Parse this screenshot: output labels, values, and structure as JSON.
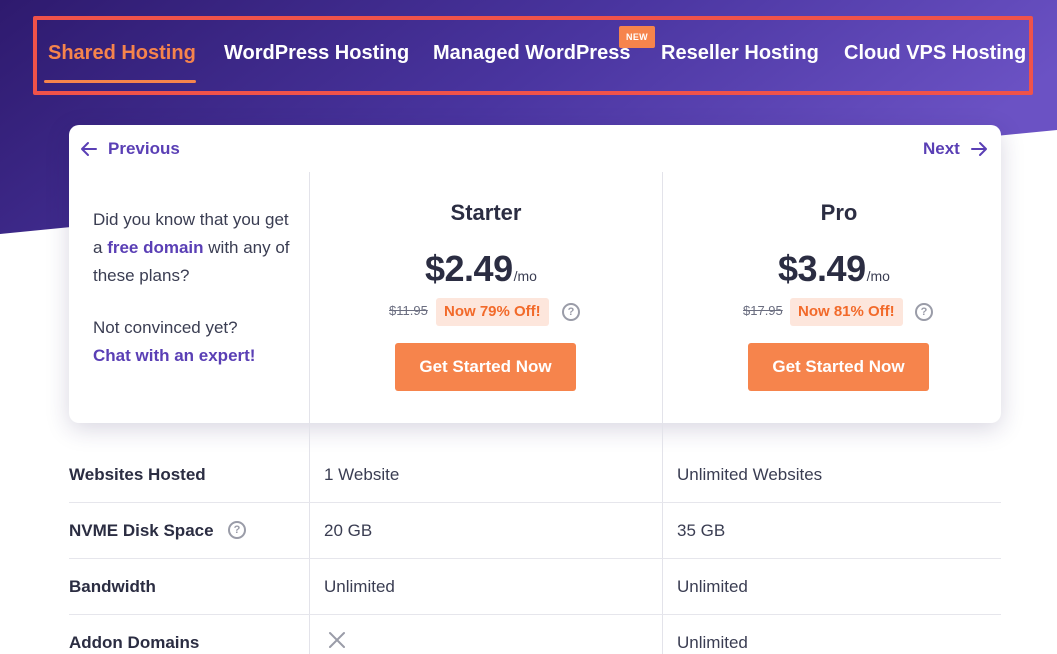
{
  "nav": {
    "tabs": [
      {
        "label": "Shared Hosting",
        "active": true
      },
      {
        "label": "WordPress Hosting",
        "active": false
      },
      {
        "label": "Managed WordPress",
        "active": false,
        "badge": "NEW"
      },
      {
        "label": "Reseller Hosting",
        "active": false
      },
      {
        "label": "Cloud VPS Hosting",
        "active": false
      }
    ]
  },
  "pager": {
    "previous_label": "Previous",
    "next_label": "Next"
  },
  "intro": {
    "line1_pre": "Did you know that you get a ",
    "line1_highlight": "free domain",
    "line1_post": " with any of these plans?",
    "line2": "Not convinced yet?",
    "chat_link": "Chat with an expert!"
  },
  "plans": [
    {
      "name": "Starter",
      "price": "$2.49",
      "per": "/mo",
      "old_price": "$11.95",
      "discount": "Now 79% Off!",
      "cta": "Get Started Now"
    },
    {
      "name": "Pro",
      "price": "$3.49",
      "per": "/mo",
      "old_price": "$17.95",
      "discount": "Now 81% Off!",
      "cta": "Get Started Now"
    }
  ],
  "features": [
    {
      "label": "Websites Hosted",
      "starter": "1 Website",
      "pro": "Unlimited Websites"
    },
    {
      "label": "NVME Disk Space",
      "starter": "20 GB",
      "pro": "35 GB",
      "has_help": true
    },
    {
      "label": "Bandwidth",
      "starter": "Unlimited",
      "pro": "Unlimited"
    },
    {
      "label": "Addon Domains",
      "starter": "",
      "starter_icon": "x-icon",
      "pro": "Unlimited"
    }
  ],
  "colors": {
    "accent_orange": "#f6844c",
    "brand_purple": "#5a3fb5",
    "highlight_frame": "#f0524a",
    "hero_dark": "#2e1a6e",
    "hero_light": "#6b52c4"
  },
  "icons": {
    "previous": "arrow-left-icon",
    "next": "arrow-right-icon",
    "help": "question-circle-icon",
    "not_included": "x-icon"
  }
}
